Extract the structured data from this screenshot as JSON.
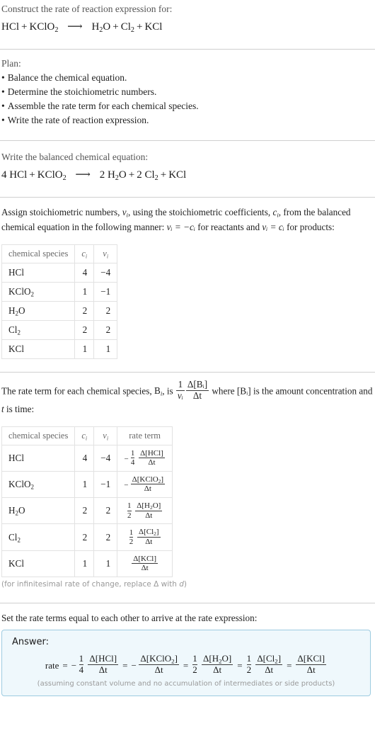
{
  "header": {
    "prompt": "Construct the rate of reaction expression for:",
    "equation": {
      "reactants": [
        {
          "formula": "HCl",
          "coefficient": ""
        },
        {
          "formula": "KClO2",
          "coefficient": ""
        }
      ],
      "products": [
        {
          "formula": "H2O",
          "coefficient": ""
        },
        {
          "formula": "Cl2",
          "coefficient": ""
        },
        {
          "formula": "KCl",
          "coefficient": ""
        }
      ],
      "arrow": "⟶",
      "plus": "+"
    }
  },
  "plan": {
    "title": "Plan:",
    "bullet": "•",
    "steps": [
      "Balance the chemical equation.",
      "Determine the stoichiometric numbers.",
      "Assemble the rate term for each chemical species.",
      "Write the rate of reaction expression."
    ]
  },
  "balanced": {
    "label": "Write the balanced chemical equation:",
    "reactants": [
      {
        "coefficient": "4",
        "formula": "HCl"
      },
      {
        "coefficient": "",
        "formula": "KClO2"
      }
    ],
    "products": [
      {
        "coefficient": "2",
        "formula": "H2O"
      },
      {
        "coefficient": "2",
        "formula": "Cl2"
      },
      {
        "coefficient": "",
        "formula": "KCl"
      }
    ],
    "arrow": "⟶"
  },
  "stoich": {
    "intro_1": "Assign stoichiometric numbers, ",
    "intro_2": ", using the stoichiometric coefficients, ",
    "intro_3": ", from the balanced chemical equation in the following manner: ",
    "intro_4": " for reactants and ",
    "intro_5": " for products:",
    "nu_symbol": "ν",
    "c_symbol": "c",
    "i_symbol": "i",
    "rule_reactant": "νᵢ = −cᵢ",
    "rule_product": "νᵢ = cᵢ",
    "table": {
      "headers": [
        "chemical species",
        "c",
        "ν"
      ],
      "header_sub": "i",
      "rows": [
        {
          "species": "HCl",
          "c": "4",
          "nu": "−4"
        },
        {
          "species": "KClO2",
          "c": "1",
          "nu": "−1"
        },
        {
          "species": "H2O",
          "c": "2",
          "nu": "2"
        },
        {
          "species": "Cl2",
          "c": "2",
          "nu": "2"
        },
        {
          "species": "KCl",
          "c": "1",
          "nu": "1"
        }
      ]
    }
  },
  "rateterm": {
    "intro_1": "The rate term for each chemical species, ",
    "intro_B": "B",
    "intro_2": ", is ",
    "intro_3": " where ",
    "intro_bracket": "[Bᵢ]",
    "intro_4": " is the amount concentration and ",
    "intro_t": "t",
    "intro_5": " is time:",
    "frac_num": "1",
    "frac_den": "νᵢ",
    "frac2_num": "Δ[Bᵢ]",
    "frac2_den": "Δt",
    "table": {
      "headers": [
        "chemical species",
        "c",
        "ν",
        "rate term"
      ],
      "header_sub": "i",
      "rows": [
        {
          "species": "HCl",
          "c": "4",
          "nu": "−4",
          "sign": "−",
          "coef_num": "1",
          "coef_den": "4",
          "delta_num": "Δ[HCl]",
          "delta_den": "Δt"
        },
        {
          "species": "KClO2",
          "c": "1",
          "nu": "−1",
          "sign": "−",
          "coef_num": "",
          "coef_den": "",
          "delta_num": "Δ[KClO2]",
          "delta_den": "Δt"
        },
        {
          "species": "H2O",
          "c": "2",
          "nu": "2",
          "sign": "",
          "coef_num": "1",
          "coef_den": "2",
          "delta_num": "Δ[H2O]",
          "delta_den": "Δt"
        },
        {
          "species": "Cl2",
          "c": "2",
          "nu": "2",
          "sign": "",
          "coef_num": "1",
          "coef_den": "2",
          "delta_num": "Δ[Cl2]",
          "delta_den": "Δt"
        },
        {
          "species": "KCl",
          "c": "1",
          "nu": "1",
          "sign": "",
          "coef_num": "",
          "coef_den": "",
          "delta_num": "Δ[KCl]",
          "delta_den": "Δt"
        }
      ]
    },
    "footnote": "(for infinitesimal rate of change, replace Δ with d)"
  },
  "answer": {
    "lead_in": "Set the rate terms equal to each other to arrive at the rate expression:",
    "label": "Answer:",
    "rate_word": "rate",
    "equals": "=",
    "terms": [
      {
        "sign": "−",
        "coef_num": "1",
        "coef_den": "4",
        "delta_num": "Δ[HCl]",
        "delta_den": "Δt"
      },
      {
        "sign": "−",
        "coef_num": "",
        "coef_den": "",
        "delta_num": "Δ[KClO2]",
        "delta_den": "Δt"
      },
      {
        "sign": "",
        "coef_num": "1",
        "coef_den": "2",
        "delta_num": "Δ[H2O]",
        "delta_den": "Δt"
      },
      {
        "sign": "",
        "coef_num": "1",
        "coef_den": "2",
        "delta_num": "Δ[Cl2]",
        "delta_den": "Δt"
      },
      {
        "sign": "",
        "coef_num": "",
        "coef_den": "",
        "delta_num": "Δ[KCl]",
        "delta_den": "Δt"
      }
    ],
    "note": "(assuming constant volume and no accumulation of intermediates or side products)"
  },
  "colors": {
    "text": "#1f1f1f",
    "muted": "#555555",
    "rule": "#cfcfcf",
    "answer_bg": "#eff8fc",
    "answer_border": "#9dcbe0",
    "table_border": "#e2e2e2"
  }
}
